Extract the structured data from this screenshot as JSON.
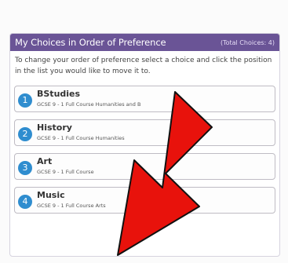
{
  "panel": {
    "title": "My Choices in Order of Preference",
    "total": "(Total Choices: 4)",
    "instructions": "To change your order of preference select a choice and click the position in the list you would like to move it to."
  },
  "choices": [
    {
      "position": "1",
      "title": "BStudies",
      "subtitle": "GCSE 9 - 1 Full Course Humanities and B"
    },
    {
      "position": "2",
      "title": "History",
      "subtitle": "GCSE 9 - 1 Full Course Humanities"
    },
    {
      "position": "3",
      "title": "Art",
      "subtitle": "GCSE 9 - 1 Full Course"
    },
    {
      "position": "4",
      "title": "Music",
      "subtitle": "GCSE 9 - 1 Full Course Arts"
    }
  ],
  "colors": {
    "header": "#6a5496",
    "badge": "#2f8dcf",
    "arrow": "#e8120c"
  },
  "icons": {
    "overlay": "down-left-arrow-icon"
  }
}
